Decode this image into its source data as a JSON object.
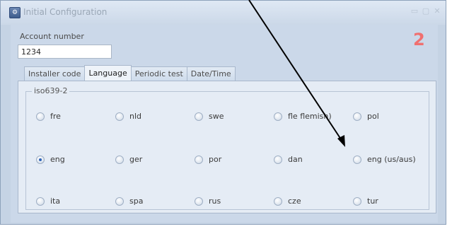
{
  "window": {
    "title": "Initial Configuration",
    "icon": "app-config-icon",
    "controls": [
      "minimize-icon",
      "maximize-icon",
      "close-icon"
    ]
  },
  "account": {
    "label": "Account number",
    "value": "1234"
  },
  "step_number": "2",
  "tabs": [
    {
      "label": "Installer code",
      "active": false
    },
    {
      "label": "Language",
      "active": true
    },
    {
      "label": "Periodic test",
      "active": false
    },
    {
      "label": "Date/Time",
      "active": false
    }
  ],
  "group": {
    "legend": "iso639-2"
  },
  "languages": [
    {
      "label": "fre",
      "checked": false
    },
    {
      "label": "nld",
      "checked": false
    },
    {
      "label": "swe",
      "checked": false
    },
    {
      "label": "fle flemish)",
      "checked": false
    },
    {
      "label": "pol",
      "checked": false
    },
    {
      "label": "eng",
      "checked": true
    },
    {
      "label": "ger",
      "checked": false
    },
    {
      "label": "por",
      "checked": false
    },
    {
      "label": "dan",
      "checked": false
    },
    {
      "label": "eng (us/aus)",
      "checked": false
    },
    {
      "label": "ita",
      "checked": false
    },
    {
      "label": "spa",
      "checked": false
    },
    {
      "label": "rus",
      "checked": false
    },
    {
      "label": "cze",
      "checked": false
    },
    {
      "label": "tur",
      "checked": false
    }
  ],
  "colors": {
    "step_number": "#f07070",
    "arrow": "#000000",
    "radio_checked": "#2f64b8"
  }
}
